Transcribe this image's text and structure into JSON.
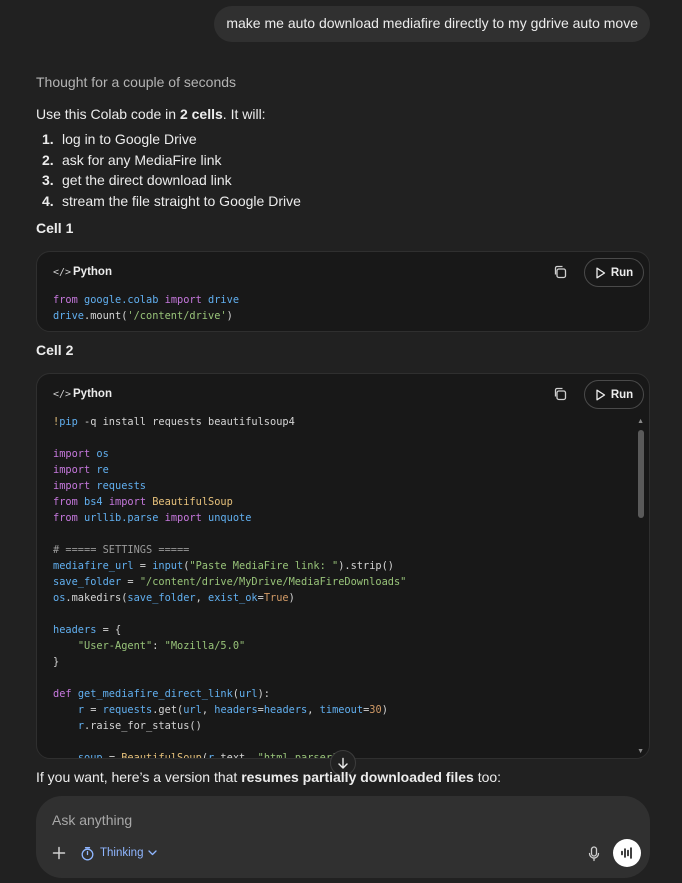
{
  "user_message": "make me auto download mediafire directly to my gdrive auto move",
  "thought": "Thought for a couple of seconds",
  "intro": {
    "prefix": "Use this Colab code in ",
    "bold": "2 cells",
    "suffix": ". It will:"
  },
  "steps": [
    {
      "num": "1.",
      "text": "log in to Google Drive"
    },
    {
      "num": "2.",
      "text": "ask for any MediaFire link"
    },
    {
      "num": "3.",
      "text": "get the direct download link"
    },
    {
      "num": "4.",
      "text": "stream the file straight to Google Drive"
    }
  ],
  "cells": [
    {
      "label": "Cell 1",
      "language": "Python",
      "run_label": "Run"
    },
    {
      "label": "Cell 2",
      "language": "Python",
      "run_label": "Run"
    }
  ],
  "follow_up": {
    "prefix": "If you want, here’s a version that ",
    "bold": "resumes partially downloaded files",
    "suffix": " too:"
  },
  "composer": {
    "placeholder": "Ask anything",
    "mode_label": "Thinking"
  },
  "colors": {
    "background": "#212121",
    "code_bg": "#181818",
    "composer_bg": "#303030",
    "accent": "#8fb6ff"
  }
}
